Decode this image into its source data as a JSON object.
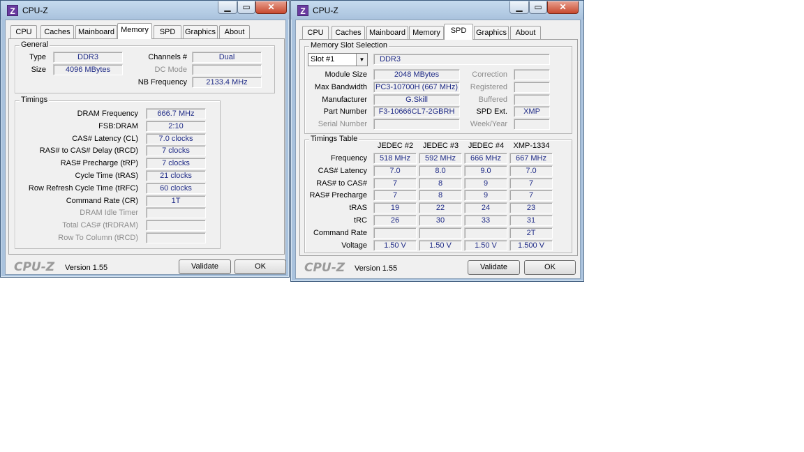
{
  "app_title": "CPU-Z",
  "tabs": [
    "CPU",
    "Caches",
    "Mainboard",
    "Memory",
    "SPD",
    "Graphics",
    "About"
  ],
  "footer": {
    "logo": "CPU-Z",
    "version": "Version 1.55",
    "validate": "Validate",
    "ok": "OK"
  },
  "window_buttons": {
    "minimize": "▁",
    "maximize": "▭",
    "close": "✕"
  },
  "memory_window": {
    "active_tab": "Memory",
    "general": {
      "title": "General",
      "type_label": "Type",
      "type_value": "DDR3",
      "size_label": "Size",
      "size_value": "4096 MBytes",
      "channels_label": "Channels #",
      "channels_value": "Dual",
      "dcmode_label": "DC Mode",
      "dcmode_value": "",
      "nbfreq_label": "NB Frequency",
      "nbfreq_value": "2133.4 MHz"
    },
    "timings": {
      "title": "Timings",
      "rows": [
        {
          "label": "DRAM Frequency",
          "value": "666.7 MHz",
          "disabled": false
        },
        {
          "label": "FSB:DRAM",
          "value": "2:10",
          "disabled": false
        },
        {
          "label": "CAS# Latency (CL)",
          "value": "7.0 clocks",
          "disabled": false
        },
        {
          "label": "RAS# to CAS# Delay (tRCD)",
          "value": "7 clocks",
          "disabled": false
        },
        {
          "label": "RAS# Precharge (tRP)",
          "value": "7 clocks",
          "disabled": false
        },
        {
          "label": "Cycle Time (tRAS)",
          "value": "21 clocks",
          "disabled": false
        },
        {
          "label": "Row Refresh Cycle Time (tRFC)",
          "value": "60 clocks",
          "disabled": false
        },
        {
          "label": "Command Rate (CR)",
          "value": "1T",
          "disabled": false
        },
        {
          "label": "DRAM Idle Timer",
          "value": "",
          "disabled": true
        },
        {
          "label": "Total CAS# (tRDRAM)",
          "value": "",
          "disabled": true
        },
        {
          "label": "Row To Column (tRCD)",
          "value": "",
          "disabled": true
        }
      ]
    }
  },
  "spd_window": {
    "active_tab": "SPD",
    "slot_group_title": "Memory Slot Selection",
    "slot_selected": "Slot #1",
    "slot_type": "DDR3",
    "left_rows": [
      {
        "label": "Module Size",
        "value": "2048 MBytes",
        "disabled": false
      },
      {
        "label": "Max Bandwidth",
        "value": "PC3-10700H (667 MHz)",
        "disabled": false
      },
      {
        "label": "Manufacturer",
        "value": "G.Skill",
        "disabled": false
      },
      {
        "label": "Part Number",
        "value": "F3-10666CL7-2GBRH",
        "disabled": false
      },
      {
        "label": "Serial Number",
        "value": "",
        "disabled": true
      }
    ],
    "right_rows": [
      {
        "label": "Correction",
        "value": "",
        "disabled": true
      },
      {
        "label": "Registered",
        "value": "",
        "disabled": true
      },
      {
        "label": "Buffered",
        "value": "",
        "disabled": true
      },
      {
        "label": "SPD Ext.",
        "value": "XMP",
        "disabled": false
      },
      {
        "label": "Week/Year",
        "value": "",
        "disabled": true
      }
    ],
    "timings_table": {
      "title": "Timings Table",
      "columns": [
        "JEDEC #2",
        "JEDEC #3",
        "JEDEC #4",
        "XMP-1334"
      ],
      "rows": [
        {
          "label": "Frequency",
          "values": [
            "518 MHz",
            "592 MHz",
            "666 MHz",
            "667 MHz"
          ]
        },
        {
          "label": "CAS# Latency",
          "values": [
            "7.0",
            "8.0",
            "9.0",
            "7.0"
          ]
        },
        {
          "label": "RAS# to CAS#",
          "values": [
            "7",
            "8",
            "9",
            "7"
          ]
        },
        {
          "label": "RAS# Precharge",
          "values": [
            "7",
            "8",
            "9",
            "7"
          ]
        },
        {
          "label": "tRAS",
          "values": [
            "19",
            "22",
            "24",
            "23"
          ]
        },
        {
          "label": "tRC",
          "values": [
            "26",
            "30",
            "33",
            "31"
          ]
        },
        {
          "label": "Command Rate",
          "values": [
            "",
            "",
            "",
            "2T"
          ]
        },
        {
          "label": "Voltage",
          "values": [
            "1.50 V",
            "1.50 V",
            "1.50 V",
            "1.500 V"
          ]
        }
      ]
    }
  }
}
